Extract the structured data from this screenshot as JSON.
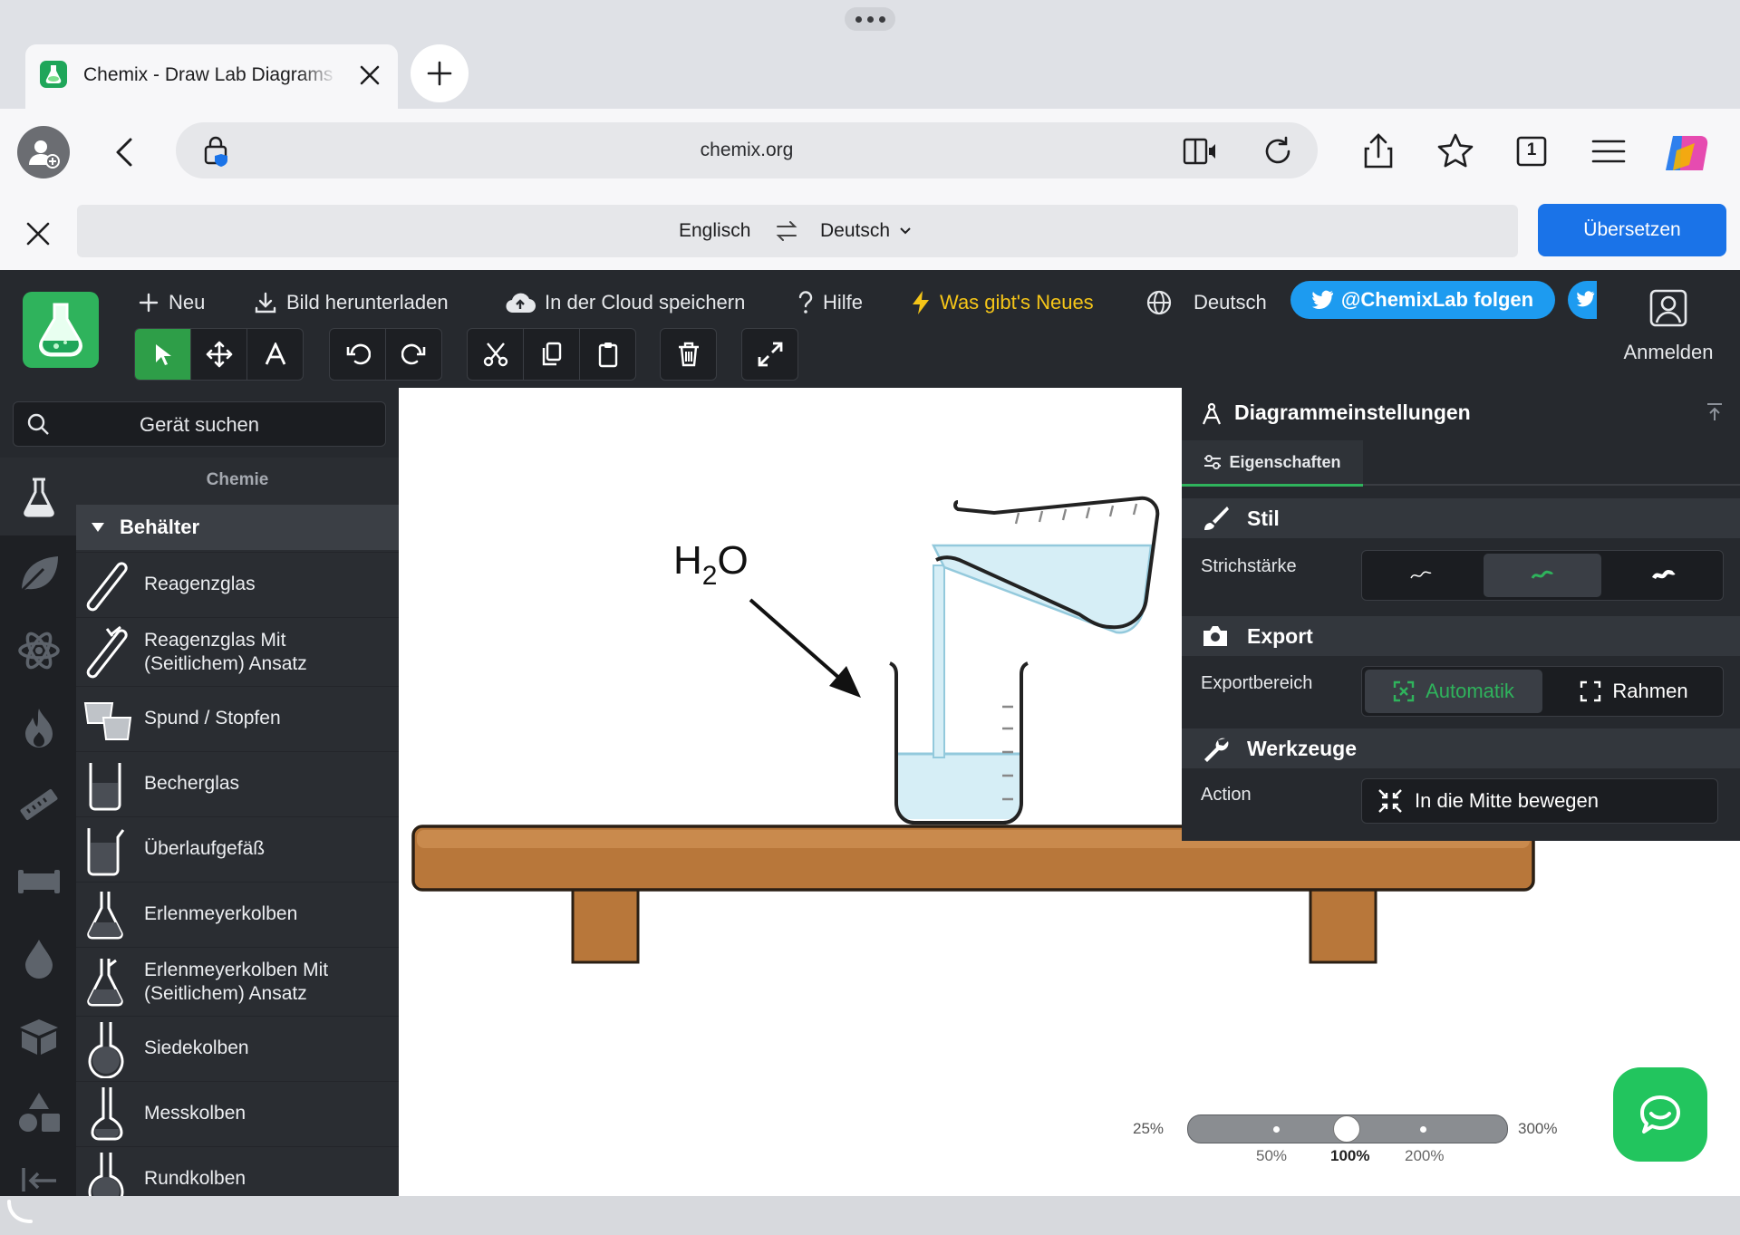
{
  "browser": {
    "tab_title": "Chemix - Draw Lab Diagrams",
    "url": "chemix.org",
    "tab_count": "1",
    "translate": {
      "from": "Englisch",
      "to": "Deutsch",
      "button": "Übersetzen"
    }
  },
  "app": {
    "menu": {
      "new": "Neu",
      "download": "Bild herunterladen",
      "cloud_save": "In der Cloud speichern",
      "help": "Hilfe",
      "whats_new": "Was gibt's Neues",
      "language": "Deutsch",
      "twitter": "@ChemixLab folgen",
      "login": "Anmelden"
    },
    "search_placeholder": "Gerät suchen",
    "category_title": "Chemie",
    "section": "Behälter",
    "items": [
      {
        "label": "Reagenzglas"
      },
      {
        "label": "Reagenzglas Mit\n(Seitlichem) Ansatz"
      },
      {
        "label": "Spund / Stopfen"
      },
      {
        "label": "Becherglas"
      },
      {
        "label": "Überlaufgefäß"
      },
      {
        "label": "Erlenmeyerkolben"
      },
      {
        "label": "Erlenmeyerkolben Mit\n(Seitlichem) Ansatz"
      },
      {
        "label": "Siedekolben"
      },
      {
        "label": "Messkolben"
      },
      {
        "label": "Rundkolben"
      }
    ],
    "canvas": {
      "label_main": "H",
      "label_sub": "2",
      "label_end": "O"
    },
    "panel": {
      "title": "Diagrammeinstellungen",
      "tab": "Eigenschaften",
      "style_section": "Stil",
      "stroke_label": "Strichstärke",
      "export_section": "Export",
      "export_label": "Exportbereich",
      "export_auto": "Automatik",
      "export_frame": "Rahmen",
      "tools_section": "Werkzeuge",
      "action_label": "Action",
      "action_button": "In die Mitte bewegen"
    },
    "zoom": {
      "min": "25%",
      "max": "300%",
      "ticks": [
        "50%",
        "100%",
        "200%"
      ],
      "current": "100%"
    }
  },
  "colors": {
    "accent_green": "#2fb35c",
    "twitter_blue": "#1d9bf0",
    "translate_blue": "#1a73e8",
    "whats_new_yellow": "#f5c518",
    "water": "#d6eef6",
    "table_wood": "#b8773a"
  }
}
